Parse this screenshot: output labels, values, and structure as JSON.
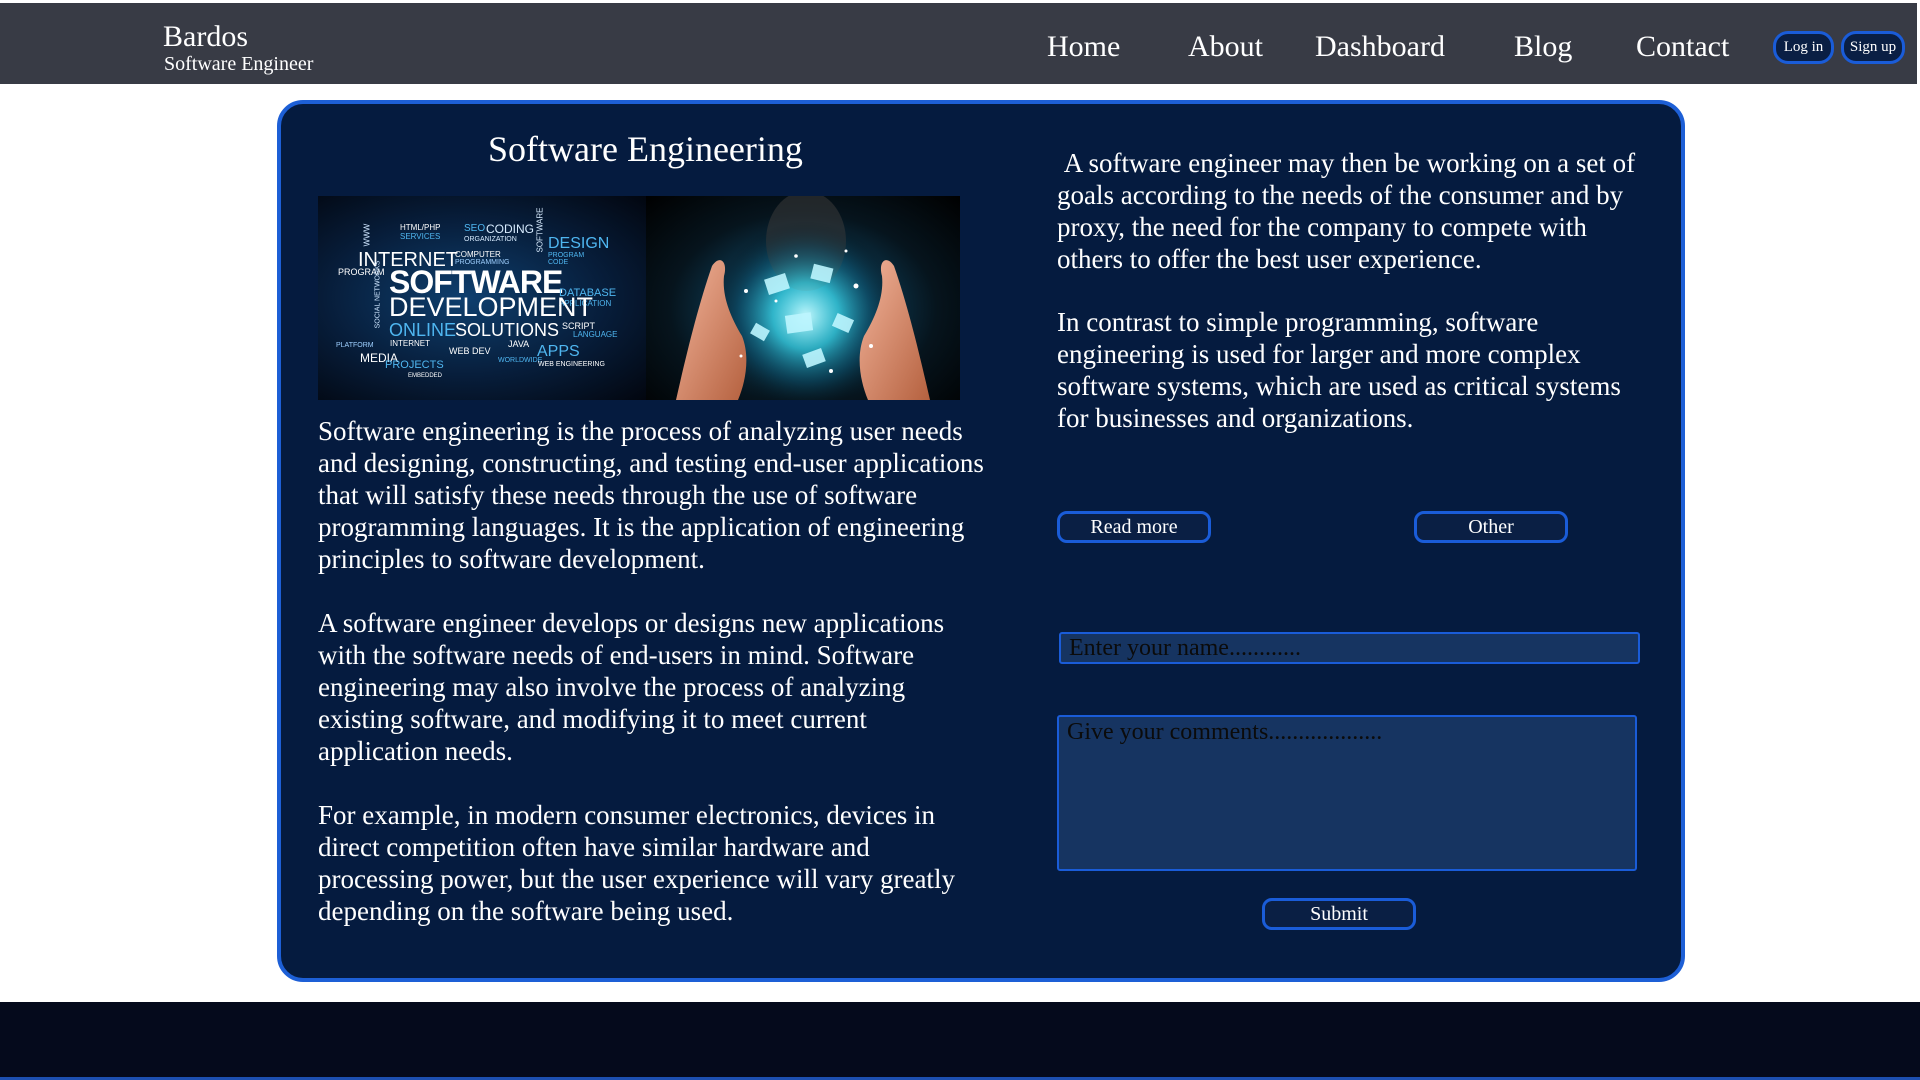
{
  "header": {
    "brand_name": "Bardos",
    "brand_subtitle": "Software Engineer",
    "nav": [
      "Home",
      "About",
      "Dashboard",
      "Blog",
      "Contact"
    ],
    "login_label": "Log in",
    "signup_label": "Sign up"
  },
  "main": {
    "heading": "Software Engineering",
    "hero_image": {
      "word_cloud": {
        "software": "SOFTWARE",
        "development": "DEVELOPMENT",
        "internet": "INTERNET",
        "online": "ONLINE",
        "solutions": "SOLUTIONS",
        "apps": "APPS",
        "design": "DESIGN",
        "database": "DATABASE",
        "projects": "PROJECTS",
        "media": "MEDIA",
        "program": "PROGRAM",
        "coding": "CODING",
        "html_php": "HTML/PHP",
        "services": "SERVICES",
        "web_dev": "WEB DEV",
        "java": "JAVA",
        "script": "SCRIPT",
        "language": "LANGUAGE",
        "www": "WWW",
        "seo": "SEO",
        "organization": "ORGANIZATION",
        "computer": "COMPUTER",
        "programming": "PROGRAMMING",
        "software_v": "SOFTWARE",
        "program_code": "PROGRAM CODE",
        "application": "APPLICATION",
        "worldwide": "WORLDWIDE",
        "web_engineering": "WEB ENGINEERING",
        "platform": "PLATFORM",
        "internet_small": "INTERNET",
        "embedded": "EMBEDDED",
        "social": "SOCIAL NETWORKS"
      }
    },
    "left_paragraphs": [
      "Software engineering is the process of analyzing user needs and designing, constructing, and testing end-user applications that will satisfy these needs through the use of software programming languages. It is the application of engineering principles to software development.",
      "A software engineer develops or designs new applications with the software needs of end-users in mind. Software engineering may also involve the process of analyzing existing software, and modifying it to meet current application needs.",
      "For example, in modern consumer electronics, devices in direct competition often have similar hardware and processing power, but the user experience will vary greatly depending on the software being used."
    ],
    "right_paragraphs": [
      " A software engineer may then be working on a set of goals according to the needs of the consumer and by proxy, the need for the company to compete with others to offer the best user experience.",
      "In contrast to simple programming, software engineering is used for larger and more complex software systems, which are used as critical systems for businesses and organizations."
    ],
    "read_more_label": "Read more",
    "other_label": "Other",
    "form": {
      "name_placeholder": "Enter your name............",
      "comments_placeholder": "Give your comments...................",
      "submit_label": "Submit"
    }
  },
  "colors": {
    "header_bg": "#383b45",
    "card_bg": "#051b3f",
    "accent_border": "#1d5fd6",
    "input_bg": "#163461",
    "footer_bg": "#050a1c"
  }
}
